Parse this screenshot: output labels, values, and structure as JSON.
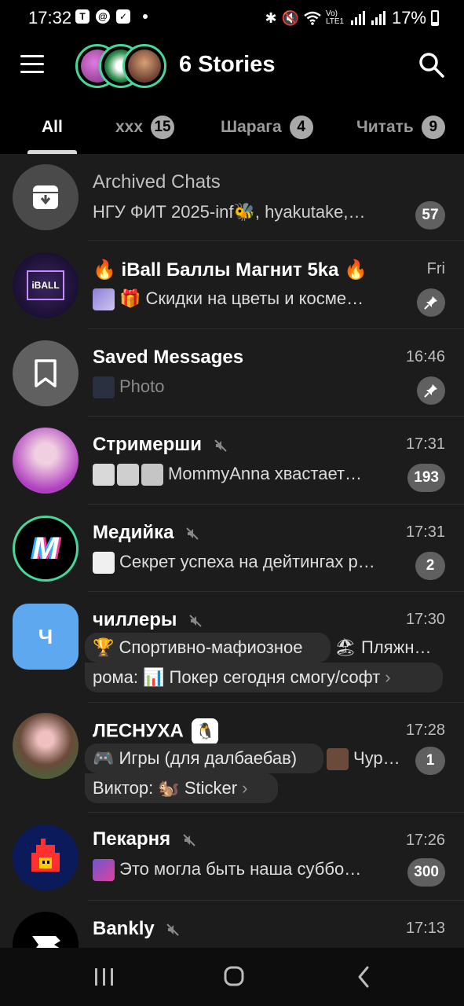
{
  "status_bar": {
    "time": "17:32",
    "battery": "17%",
    "network": "Vo) LTE1"
  },
  "header": {
    "title": "6 Stories"
  },
  "tabs": [
    {
      "label": "All",
      "count": null
    },
    {
      "label": "xxx",
      "count": "15"
    },
    {
      "label": "Шарага",
      "count": "4"
    },
    {
      "label": "Читать",
      "count": "9"
    }
  ],
  "chats": [
    {
      "title": "Archived Chats",
      "message": "НГУ ФИТ 2025-inf🐝, hyakutake,…",
      "badge": "57"
    },
    {
      "title": "🔥 iBall Баллы Магнит 5ka 🔥",
      "time": "Fri",
      "message": "🎁 Скидки на цветы и косме…",
      "pinned": true,
      "avatar_text": "iBALL"
    },
    {
      "title": "Saved Messages",
      "time": "16:46",
      "message": "Photo",
      "pinned": true
    },
    {
      "title": "Стримерши",
      "time": "17:31",
      "message": "MommyAnna хвастает…",
      "badge": "193",
      "muted": true
    },
    {
      "title": "Медийка",
      "time": "17:31",
      "message": "Секрет успеха на дейтингах р…",
      "badge": "2",
      "muted": true,
      "avatar_text": "M"
    },
    {
      "title": "чиллеры",
      "time": "17:30",
      "avatar_text": "Ч",
      "muted": true,
      "topic1": "🏆 Спортивно-мафиозное",
      "topic1b": "🏖 Пляжн…",
      "line2": "рома: 📊 Покер сегодня смогу/софт"
    },
    {
      "title": "ЛЕСНУХА",
      "time": "17:28",
      "badge": "1",
      "topic1": "🎮 Игры (для далбаебав)",
      "topic1b": "Чур…",
      "line2": "Виктор: 🐿️ Sticker"
    },
    {
      "title": "Пекарня",
      "time": "17:26",
      "message": "Это могла быть наша суббо…",
      "badge": "300",
      "muted": true
    },
    {
      "title": "Bankly",
      "time": "17:13",
      "muted": true
    }
  ],
  "colors": {
    "accent": "#46d79a",
    "badge_bg": "#606060",
    "blue_avatar": "#5ea8f0"
  }
}
